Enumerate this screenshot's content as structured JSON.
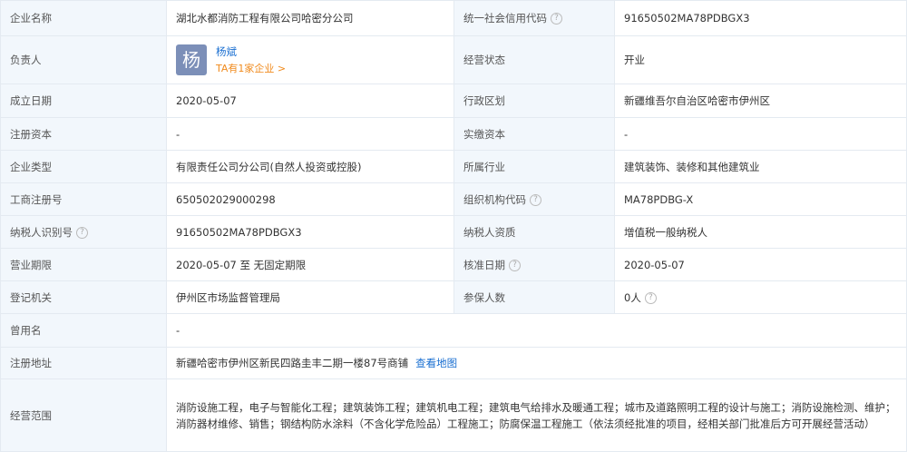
{
  "rows": {
    "company_name": {
      "label": "企业名称",
      "value": "湖北水都消防工程有限公司哈密分公司"
    },
    "credit_code": {
      "label": "统一社会信用代码",
      "value": "91650502MA78PDBGX3"
    },
    "person": {
      "label": "负责人",
      "avatar_char": "杨",
      "name": "杨斌",
      "tag": "TA有1家企业 >"
    },
    "status": {
      "label": "经营状态",
      "value": "开业"
    },
    "founded": {
      "label": "成立日期",
      "value": "2020-05-07"
    },
    "region": {
      "label": "行政区划",
      "value": "新疆维吾尔自治区哈密市伊州区"
    },
    "reg_capital": {
      "label": "注册资本",
      "value": "-"
    },
    "paid_capital": {
      "label": "实缴资本",
      "value": "-"
    },
    "company_type": {
      "label": "企业类型",
      "value": "有限责任公司分公司(自然人投资或控股)"
    },
    "industry": {
      "label": "所属行业",
      "value": "建筑装饰、装修和其他建筑业"
    },
    "reg_number": {
      "label": "工商注册号",
      "value": "650502029000298"
    },
    "org_code": {
      "label": "组织机构代码",
      "value": "MA78PDBG-X"
    },
    "taxpayer_id": {
      "label": "纳税人识别号",
      "value": "91650502MA78PDBGX3"
    },
    "taxpayer_qual": {
      "label": "纳税人资质",
      "value": "增值税一般纳税人"
    },
    "term": {
      "label": "营业期限",
      "value": "2020-05-07 至 无固定期限"
    },
    "approved": {
      "label": "核准日期",
      "value": "2020-05-07"
    },
    "authority": {
      "label": "登记机关",
      "value": "伊州区市场监督管理局"
    },
    "insured": {
      "label": "参保人数",
      "value": "0人"
    },
    "former_name": {
      "label": "曾用名",
      "value": "-"
    },
    "address": {
      "label": "注册地址",
      "value": "新疆哈密市伊州区新民四路圭丰二期一楼87号商铺",
      "link": "查看地图"
    },
    "scope": {
      "label": "经营范围",
      "value": "消防设施工程，电子与智能化工程；建筑装饰工程；建筑机电工程；建筑电气给排水及暖通工程；城市及道路照明工程的设计与施工；消防设施检测、维护；消防器材维修、销售；钢结构防水涂料（不含化学危险品）工程施工；防腐保温工程施工（依法须经批准的项目，经相关部门批准后方可开展经营活动）"
    }
  },
  "help_glyph": "?"
}
